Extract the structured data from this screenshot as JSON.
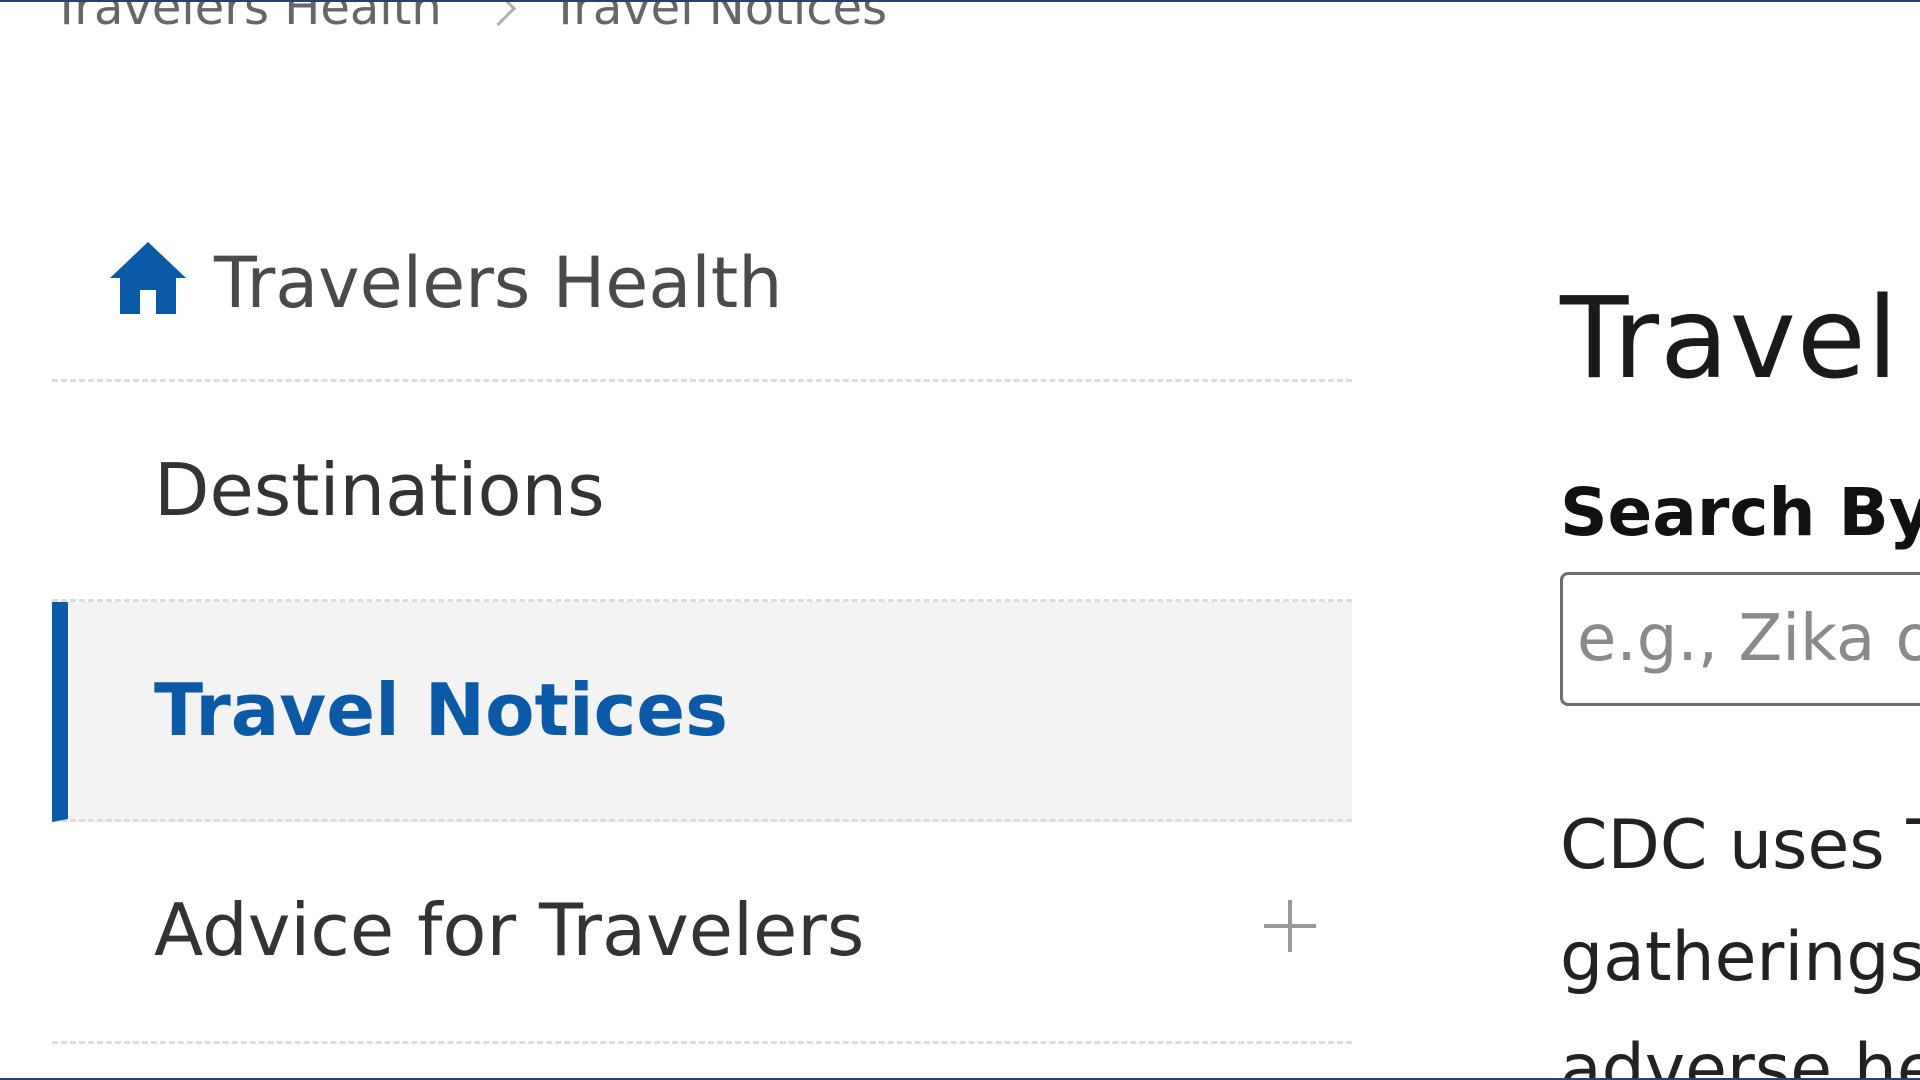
{
  "breadcrumb": {
    "items": [
      "Travelers Health",
      "Travel Notices"
    ]
  },
  "sidenav": {
    "home": {
      "label": "Travelers Health",
      "icon": "home-icon"
    },
    "items": [
      {
        "label": "Destinations"
      },
      {
        "label": "Travel Notices",
        "active": true
      },
      {
        "label": "Advice for Travelers",
        "icon": "plus-icon"
      }
    ]
  },
  "main": {
    "title": "Travel",
    "search": {
      "label": "Search By",
      "placeholder": "e.g., Zika o"
    },
    "intro_lines": [
      "CDC uses T",
      "gatherings",
      "adverse he"
    ]
  },
  "colors": {
    "accent": "#0a5aa8",
    "active_bg": "#f3f3f3",
    "frame_border": "#2a3f6b"
  }
}
